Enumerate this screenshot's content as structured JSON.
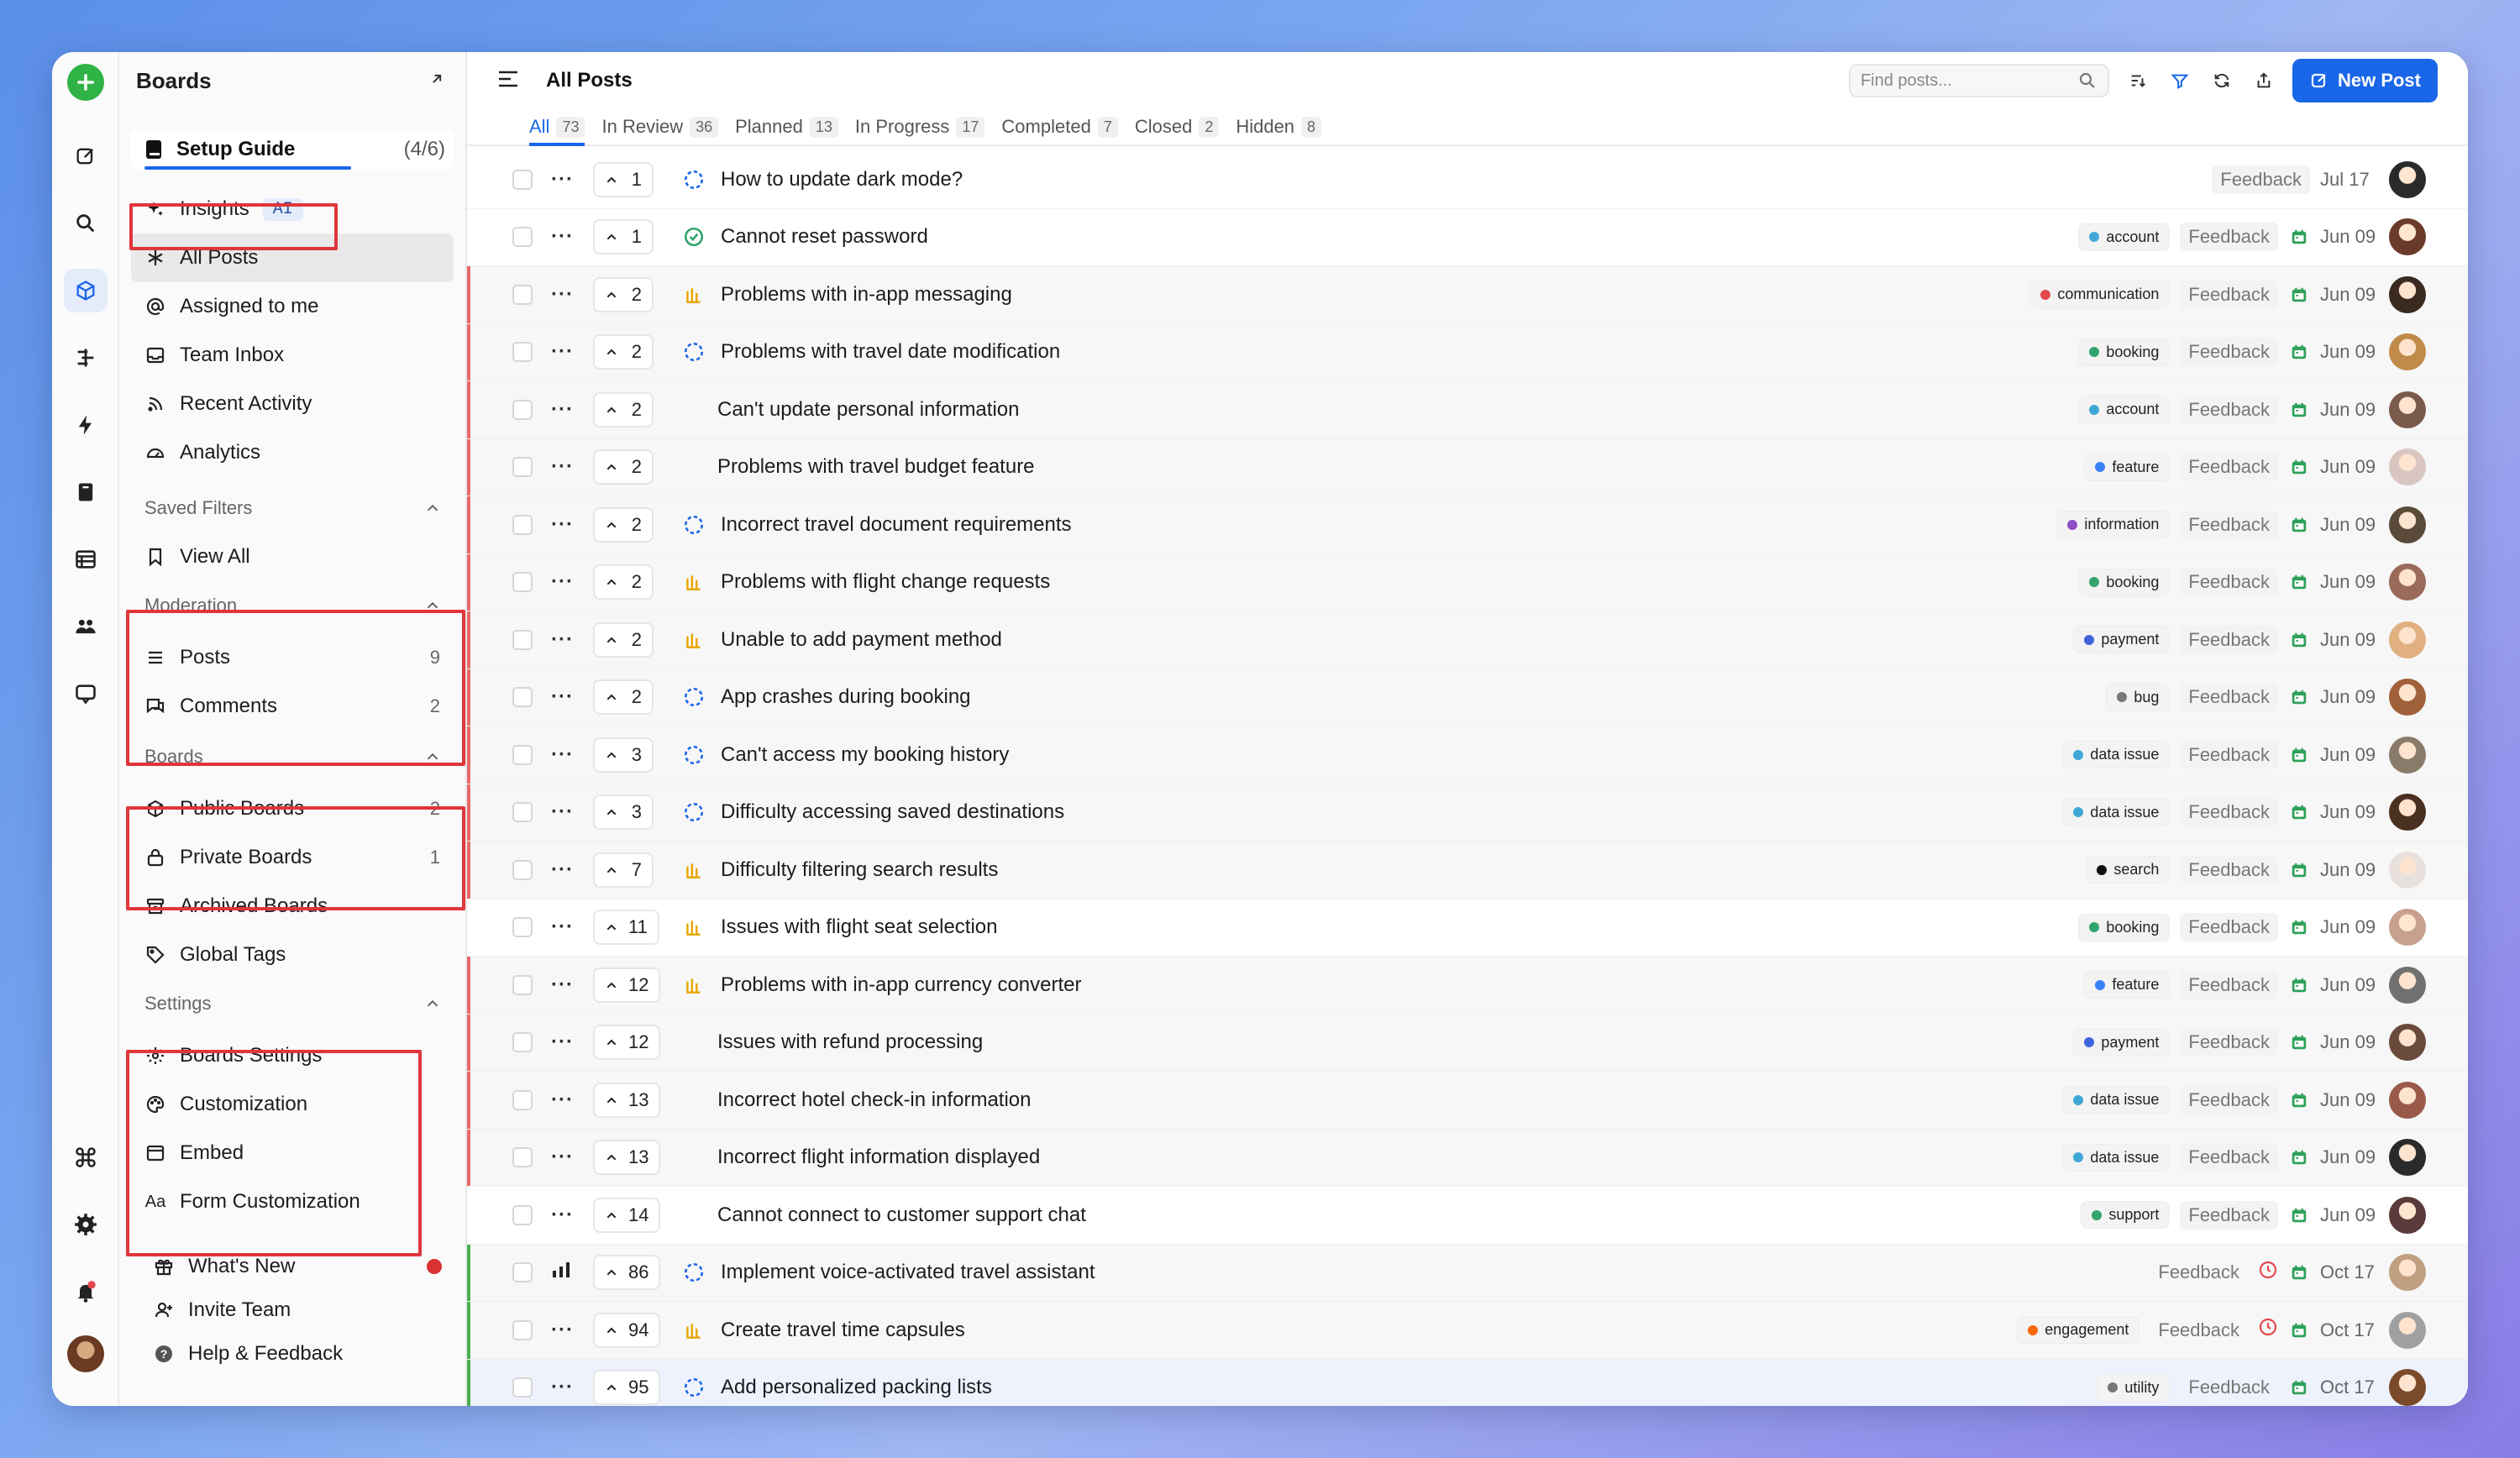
{
  "sidebar": {
    "title": "Boards",
    "setup": {
      "label": "Setup Guide",
      "progress": "(4/6)"
    },
    "insights": {
      "label": "Insights",
      "badge": "AI"
    },
    "nav": [
      {
        "label": "All Posts",
        "icon": "asterisk-icon"
      },
      {
        "label": "Assigned to me",
        "icon": "at-icon"
      },
      {
        "label": "Team Inbox",
        "icon": "inbox-icon"
      },
      {
        "label": "Recent Activity",
        "icon": "rss-icon"
      },
      {
        "label": "Analytics",
        "icon": "gauge-icon"
      }
    ],
    "saved_filters": {
      "heading": "Saved Filters",
      "items": [
        {
          "label": "View All"
        }
      ]
    },
    "moderation": {
      "heading": "Moderation",
      "items": [
        {
          "label": "Posts",
          "count": "9"
        },
        {
          "label": "Comments",
          "count": "2"
        }
      ]
    },
    "boards": {
      "heading": "Boards",
      "items": [
        {
          "label": "Public Boards",
          "count": "2"
        },
        {
          "label": "Private Boards",
          "count": "1"
        },
        {
          "label": "Archived Boards"
        },
        {
          "label": "Global Tags"
        }
      ]
    },
    "settings": {
      "heading": "Settings",
      "items": [
        {
          "label": "Boards Settings"
        },
        {
          "label": "Customization"
        },
        {
          "label": "Embed"
        },
        {
          "label": "Form Customization"
        }
      ]
    },
    "footer": [
      {
        "label": "What's New"
      },
      {
        "label": "Invite Team"
      },
      {
        "label": "Help & Feedback"
      }
    ]
  },
  "header": {
    "title": "All Posts",
    "search_placeholder": "Find posts...",
    "new_post": "New Post"
  },
  "tabs": [
    {
      "label": "All",
      "count": "73"
    },
    {
      "label": "In Review",
      "count": "36"
    },
    {
      "label": "Planned",
      "count": "13"
    },
    {
      "label": "In Progress",
      "count": "17"
    },
    {
      "label": "Completed",
      "count": "7"
    },
    {
      "label": "Closed",
      "count": "2"
    },
    {
      "label": "Hidden",
      "count": "8"
    }
  ],
  "posts": [
    {
      "votes": "1",
      "title": "How to update dark mode?",
      "status": "in-review",
      "tag": "",
      "tag_color": "",
      "board": "Feedback",
      "date": "Jul 17",
      "stripe": "#ffffff",
      "shade": false,
      "eta": false,
      "avatar": "#2a2a2a"
    },
    {
      "votes": "1",
      "title": "Cannot reset password",
      "status": "completed",
      "tag": "account",
      "tag_color": "#3fa7d6",
      "board": "Feedback",
      "date": "Jun 09",
      "stripe": "#ffffff",
      "shade": false,
      "eta": false,
      "avatar": "#6b3b2a"
    },
    {
      "votes": "2",
      "title": "Problems with in-app messaging",
      "status": "in-progress",
      "tag": "communication",
      "tag_color": "#e5484d",
      "board": "Feedback",
      "date": "Jun 09",
      "stripe": "#e86a6a",
      "shade": true,
      "eta": false,
      "avatar": "#3b2a20"
    },
    {
      "votes": "2",
      "title": "Problems with travel date modification",
      "status": "in-review",
      "tag": "booking",
      "tag_color": "#30a46c",
      "board": "Feedback",
      "date": "Jun 09",
      "stripe": "#e86a6a",
      "shade": true,
      "eta": false,
      "avatar": "#c08a4a"
    },
    {
      "votes": "2",
      "title": "Can't update personal information",
      "status": "",
      "tag": "account",
      "tag_color": "#3fa7d6",
      "board": "Feedback",
      "date": "Jun 09",
      "stripe": "#e86a6a",
      "shade": true,
      "eta": false,
      "avatar": "#7a5a4a"
    },
    {
      "votes": "2",
      "title": "Problems with travel budget feature",
      "status": "",
      "tag": "feature",
      "tag_color": "#3b82f6",
      "board": "Feedback",
      "date": "Jun 09",
      "stripe": "#e86a6a",
      "shade": true,
      "eta": false,
      "avatar": "#d9c6c0"
    },
    {
      "votes": "2",
      "title": "Incorrect travel document requirements",
      "status": "in-review",
      "tag": "information",
      "tag_color": "#8e4ec6",
      "board": "Feedback",
      "date": "Jun 09",
      "stripe": "#e86a6a",
      "shade": true,
      "eta": false,
      "avatar": "#5a4a3a"
    },
    {
      "votes": "2",
      "title": "Problems with flight change requests",
      "status": "in-progress",
      "tag": "booking",
      "tag_color": "#30a46c",
      "board": "Feedback",
      "date": "Jun 09",
      "stripe": "#e86a6a",
      "shade": true,
      "eta": false,
      "avatar": "#9a6a5a"
    },
    {
      "votes": "2",
      "title": "Unable to add payment method",
      "status": "in-progress",
      "tag": "payment",
      "tag_color": "#3e63dd",
      "board": "Feedback",
      "date": "Jun 09",
      "stripe": "#e86a6a",
      "shade": true,
      "eta": false,
      "avatar": "#e0b080"
    },
    {
      "votes": "2",
      "title": "App crashes during booking",
      "status": "in-review",
      "tag": "bug",
      "tag_color": "#777777",
      "board": "Feedback",
      "date": "Jun 09",
      "stripe": "#e86a6a",
      "shade": true,
      "eta": false,
      "avatar": "#a0603a"
    },
    {
      "votes": "3",
      "title": "Can't access my booking history",
      "status": "in-review",
      "tag": "data issue",
      "tag_color": "#3fa7d6",
      "board": "Feedback",
      "date": "Jun 09",
      "stripe": "#e86a6a",
      "shade": true,
      "eta": false,
      "avatar": "#8a7a6a"
    },
    {
      "votes": "3",
      "title": "Difficulty accessing saved destinations",
      "status": "in-review",
      "tag": "data issue",
      "tag_color": "#3fa7d6",
      "board": "Feedback",
      "date": "Jun 09",
      "stripe": "#e86a6a",
      "shade": true,
      "eta": false,
      "avatar": "#4a3020"
    },
    {
      "votes": "7",
      "title": "Difficulty filtering search results",
      "status": "in-progress",
      "tag": "search",
      "tag_color": "#111111",
      "board": "Feedback",
      "date": "Jun 09",
      "stripe": "#e86a6a",
      "shade": true,
      "eta": false,
      "avatar": "#e8e0dc"
    },
    {
      "votes": "11",
      "title": "Issues with flight seat selection",
      "status": "in-progress",
      "tag": "booking",
      "tag_color": "#30a46c",
      "board": "Feedback",
      "date": "Jun 09",
      "stripe": "#ffffff",
      "shade": false,
      "eta": false,
      "avatar": "#c8a090"
    },
    {
      "votes": "12",
      "title": "Problems with in-app currency converter",
      "status": "in-progress",
      "tag": "feature",
      "tag_color": "#3b82f6",
      "board": "Feedback",
      "date": "Jun 09",
      "stripe": "#e86a6a",
      "shade": true,
      "eta": false,
      "avatar": "#707070"
    },
    {
      "votes": "12",
      "title": "Issues with refund processing",
      "status": "",
      "tag": "payment",
      "tag_color": "#3e63dd",
      "board": "Feedback",
      "date": "Jun 09",
      "stripe": "#e86a6a",
      "shade": true,
      "eta": false,
      "avatar": "#6a4a3a"
    },
    {
      "votes": "13",
      "title": "Incorrect hotel check-in information",
      "status": "",
      "tag": "data issue",
      "tag_color": "#3fa7d6",
      "board": "Feedback",
      "date": "Jun 09",
      "stripe": "#e86a6a",
      "shade": true,
      "eta": false,
      "avatar": "#9a5a4a"
    },
    {
      "votes": "13",
      "title": "Incorrect flight information displayed",
      "status": "",
      "tag": "data issue",
      "tag_color": "#3fa7d6",
      "board": "Feedback",
      "date": "Jun 09",
      "stripe": "#e86a6a",
      "shade": true,
      "eta": false,
      "avatar": "#2a2a2a"
    },
    {
      "votes": "14",
      "title": "Cannot connect to customer support chat",
      "status": "",
      "tag": "support",
      "tag_color": "#30a46c",
      "board": "Feedback",
      "date": "Jun 09",
      "stripe": "#ffffff",
      "shade": false,
      "eta": false,
      "avatar": "#5a3a3a"
    },
    {
      "votes": "86",
      "title": "Implement voice-activated travel assistant",
      "status": "in-review",
      "tag": "",
      "tag_color": "",
      "board": "Feedback",
      "date": "Oct 17",
      "stripe": "#4caf50",
      "shade": true,
      "eta": true,
      "avatar": "#c0a080"
    },
    {
      "votes": "94",
      "title": "Create travel time capsules",
      "status": "in-progress",
      "tag": "engagement",
      "tag_color": "#f76808",
      "board": "Feedback",
      "date": "Oct 17",
      "stripe": "#4caf50",
      "shade": true,
      "eta": true,
      "avatar": "#a0a0a0"
    },
    {
      "votes": "95",
      "title": "Add personalized packing lists",
      "status": "in-review",
      "tag": "utility",
      "tag_color": "#777777",
      "board": "Feedback",
      "date": "Oct 17",
      "stripe": "#4caf50",
      "shade": false,
      "hl": true,
      "eta": false,
      "avatar": "#7a4a2a"
    }
  ],
  "colors": {
    "accent": "#1a66e8",
    "highlight_box": "#e0353b",
    "calendar": "#2fa05a",
    "in_review": "#1a66e8",
    "completed": "#30a46c",
    "in_progress": "#e8a500"
  }
}
